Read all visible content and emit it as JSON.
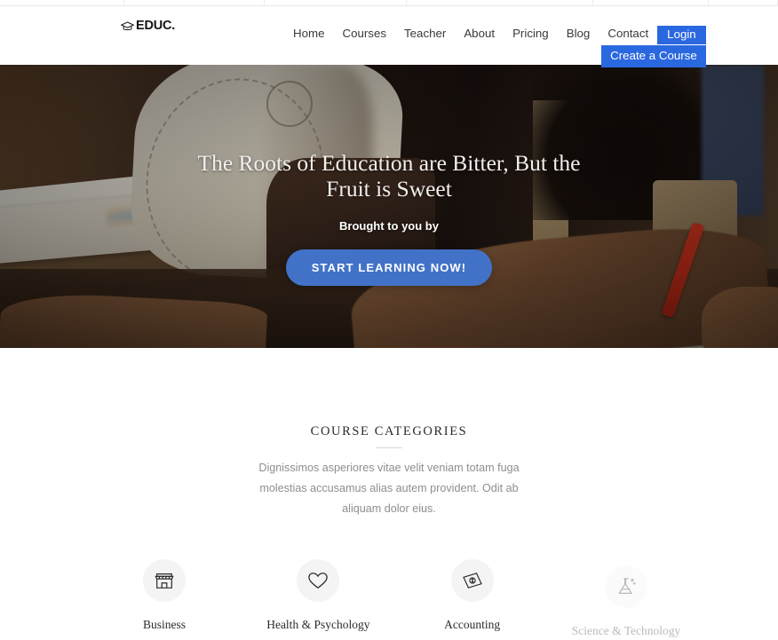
{
  "browser": {
    "tab_widths": [
      140,
      158,
      160,
      210,
      130,
      78
    ]
  },
  "header": {
    "logo": {
      "icon": "graduation-cap-icon",
      "text": "EDUC."
    },
    "nav": [
      {
        "label": "Home"
      },
      {
        "label": "Courses"
      },
      {
        "label": "Teacher"
      },
      {
        "label": "About"
      },
      {
        "label": "Pricing"
      },
      {
        "label": "Blog"
      },
      {
        "label": "Contact"
      }
    ],
    "login_label": "Login",
    "create_course_label": "Create a Course",
    "accent_color": "#2a68e0"
  },
  "hero": {
    "title": "The Roots of Education are Bitter, But the Fruit is Sweet",
    "subtitle": "Brought to you by",
    "cta_label": "START LEARNING NOW!",
    "cta_color": "#4272c8",
    "dots": [
      {
        "active": true
      },
      {
        "active": false
      },
      {
        "active": false
      }
    ]
  },
  "categories": {
    "heading": "COURSE CATEGORIES",
    "description": "Dignissimos asperiores vitae velit veniam totam fuga molestias accusamus alias autem provident. Odit ab aliquam dolor eius.",
    "items": [
      {
        "label": "Business",
        "icon": "storefront-icon",
        "pending": false
      },
      {
        "label": "Health & Psychology",
        "icon": "heart-icon",
        "pending": false
      },
      {
        "label": "Accounting",
        "icon": "banknote-icon",
        "pending": false
      },
      {
        "label": "Science & Technology",
        "icon": "flask-icon",
        "pending": true
      }
    ],
    "circle_color": "#f4f4f4"
  }
}
